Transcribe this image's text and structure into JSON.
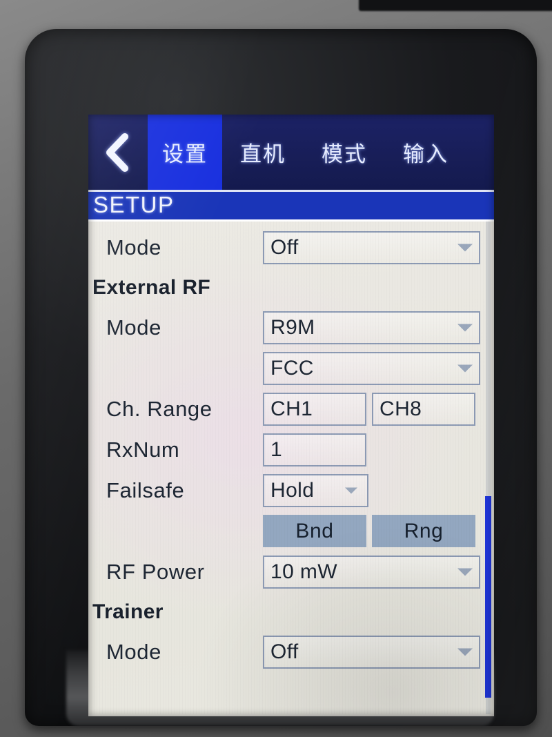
{
  "header": {
    "back_icon": "chevron-left-icon",
    "tabs": [
      {
        "label": "设置",
        "selected": true
      },
      {
        "label": "直机",
        "selected": false
      },
      {
        "label": "模式",
        "selected": false
      },
      {
        "label": "输入",
        "selected": false
      }
    ]
  },
  "page": {
    "title": "SETUP"
  },
  "rows": {
    "internal_mode_label": "Mode",
    "internal_mode_value": "Off",
    "external_rf_header": "External RF",
    "external_mode_label": "Mode",
    "external_mode_value": "R9M",
    "external_region_value": "FCC",
    "ch_range_label": "Ch. Range",
    "ch_range_start": "CH1",
    "ch_range_end": "CH8",
    "rxnum_label": "RxNum",
    "rxnum_value": "1",
    "failsafe_label": "Failsafe",
    "failsafe_value": "Hold",
    "bind_button": "Bnd",
    "range_button": "Rng",
    "rf_power_label": "RF Power",
    "rf_power_value": "10 mW",
    "trainer_header": "Trainer",
    "trainer_mode_label": "Mode",
    "trainer_mode_value": "Off"
  },
  "colors": {
    "tab_selected_bg": "#1930df",
    "tabbar_bg": "#181e58",
    "title_bar_bg": "#1a35b8",
    "screen_bg": "#e9e7e1",
    "button_bg": "#93a7c0",
    "scrollbar_thumb": "#1f35d8",
    "field_border": "#8c9ab4",
    "text": "#1d2633"
  },
  "icons": {
    "dropdown": "chevron-down-icon"
  }
}
